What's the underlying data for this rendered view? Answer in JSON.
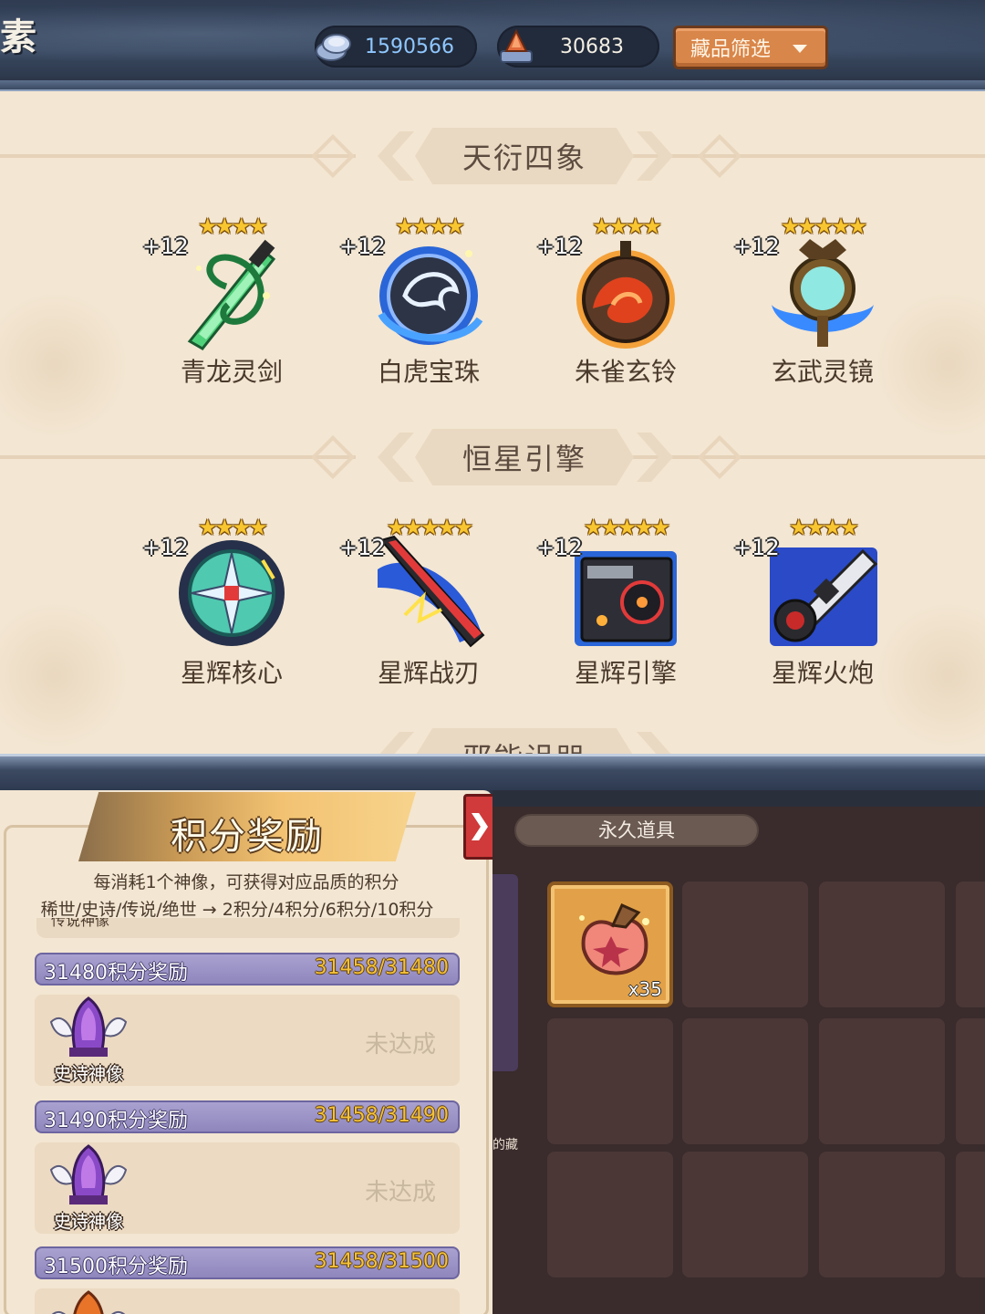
{
  "hud": {
    "corner_char": "素",
    "silver_amount": "1590566",
    "silver_icon": "silver-coins-icon",
    "gem_amount": "30683",
    "gem_icon": "red-crystal-icon",
    "filter_label": "藏品筛选"
  },
  "collection": {
    "sections": [
      {
        "title": "天衍四象",
        "items": [
          {
            "name": "青龙灵剑",
            "level": "+12",
            "stars": "★★★★",
            "icon": "green-dragon-sword-icon"
          },
          {
            "name": "白虎宝珠",
            "level": "+12",
            "stars": "★★★★",
            "icon": "white-tiger-orb-icon"
          },
          {
            "name": "朱雀玄铃",
            "level": "+12",
            "stars": "★★★★",
            "icon": "vermilion-bird-bell-icon"
          },
          {
            "name": "玄武灵镜",
            "level": "+12",
            "stars": "★★★★★",
            "icon": "black-tortoise-mirror-icon"
          }
        ]
      },
      {
        "title": "恒星引擎",
        "items": [
          {
            "name": "星辉核心",
            "level": "+12",
            "stars": "★★★★",
            "icon": "star-core-icon"
          },
          {
            "name": "星辉战刃",
            "level": "+12",
            "stars": "★★★★★",
            "icon": "star-blade-icon"
          },
          {
            "name": "星辉引擎",
            "level": "+12",
            "stars": "★★★★★",
            "icon": "star-engine-icon"
          },
          {
            "name": "星辉火炮",
            "level": "+12",
            "stars": "★★★★",
            "icon": "star-cannon-icon"
          }
        ]
      }
    ],
    "next_section_title": "邪能诅咒"
  },
  "rewards": {
    "title": "积分奖励",
    "desc_line1": "每消耗1个神像，可获得对应品质的积分",
    "desc_line2": "稀世/史诗/传说/绝世 → 2积分/4积分/6积分/10积分",
    "cut_label": "传说神像",
    "tiers": [
      {
        "label": "31480积分奖励",
        "progress": "31458/31480",
        "reward": "史诗神像",
        "status": "未达成",
        "reward_icon": "epic-statue-icon"
      },
      {
        "label": "31490积分奖励",
        "progress": "31458/31490",
        "reward": "史诗神像",
        "status": "未达成",
        "reward_icon": "epic-statue-icon"
      },
      {
        "label": "31500积分奖励",
        "progress": "31458/31500",
        "reward": "",
        "status": "",
        "reward_icon": "legendary-statue-icon"
      }
    ]
  },
  "inventory": {
    "tab_label": "永久道具",
    "side_peek_text": "的藏",
    "first_item": {
      "icon": "gift-bag-icon",
      "quantity": "x35"
    }
  },
  "colors": {
    "panel_bg": "#f3e6d2",
    "tier_bar": "#9f97c8",
    "progress_gold": "#f4c23a",
    "filter_orange": "#d9864a",
    "inventory_bg": "#3a2b2c"
  }
}
